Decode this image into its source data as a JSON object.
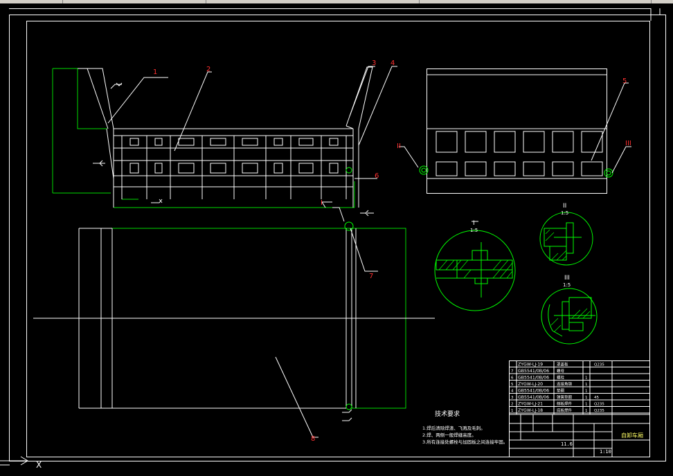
{
  "window": {
    "title": ""
  },
  "colors": {
    "background": "#000000",
    "white_line": "#ffffff",
    "green_line": "#00ff00",
    "red_label": "#ff2020",
    "yellow_text": "#ffff66"
  },
  "part_labels": [
    "1",
    "2",
    "3",
    "4",
    "5",
    "6",
    "7",
    "8"
  ],
  "detail_labels": {
    "I": "I",
    "II": "II",
    "III": "III"
  },
  "detail_views": [
    {
      "id": "I",
      "title": "I",
      "scale": "1:5"
    },
    {
      "id": "II",
      "title": "II",
      "scale": "1:5"
    },
    {
      "id": "III",
      "title": "III",
      "scale": "1:5"
    }
  ],
  "tech_requirements": {
    "title": "技术要求",
    "items": [
      "1.焊后清除焊渣、飞溅及毛刺。",
      "2.焊、两侧一般焊缝高度。",
      "3.所有连接处螺栓与加固板之间连接牢固。"
    ]
  },
  "bom": [
    {
      "no": "",
      "code": "ZYGW-LJ-19",
      "name": "罩盖板",
      "qty": "",
      "material": "Q235"
    },
    {
      "no": "7",
      "code": "GB5541/0B/06",
      "name": "螺母",
      "qty": "",
      "material": ""
    },
    {
      "no": "6",
      "code": "GB5541/0B/06",
      "name": "螺栓",
      "qty": "1",
      "material": ""
    },
    {
      "no": "5",
      "code": "ZYGW-LJ-20",
      "name": "连接角钢",
      "qty": "1",
      "material": ""
    },
    {
      "no": "4",
      "code": "GB5541/0B/06",
      "name": "垫圈",
      "qty": "1",
      "material": ""
    },
    {
      "no": "3",
      "code": "GB5541/0B/06",
      "name": "弹簧垫圈",
      "qty": "1",
      "material": "45"
    },
    {
      "no": "2",
      "code": "ZYGW-LJ-21",
      "name": "侧板焊件",
      "qty": "1",
      "material": "Q235"
    },
    {
      "no": "1",
      "code": "ZYGW-LJ-18",
      "name": "底板焊件",
      "qty": "1",
      "material": "Q235"
    }
  ],
  "title_block": {
    "company": "",
    "drawing_name": "自卸车厢",
    "scale": "1:10",
    "weight": "11.6",
    "sheet": "",
    "stage": ""
  },
  "ucs": {
    "x_label": "X"
  }
}
